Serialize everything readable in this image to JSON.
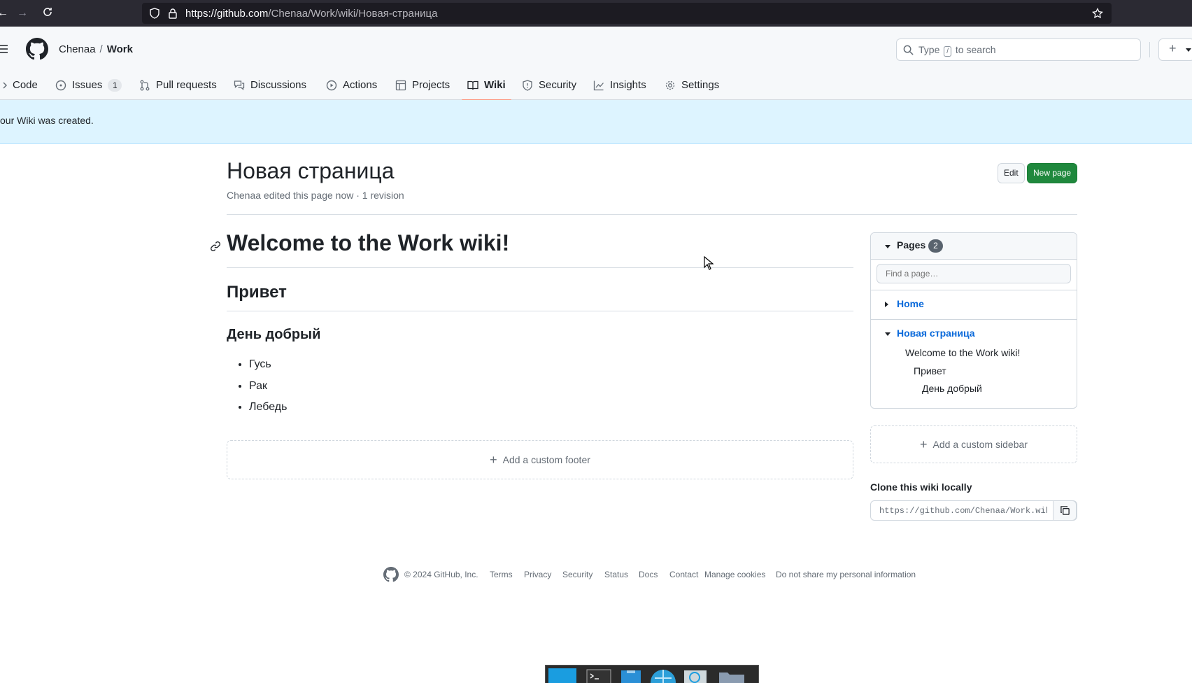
{
  "browser": {
    "url_host": "https://github.com",
    "url_path": "/Chenaa/Work/wiki/Новая-страница"
  },
  "header": {
    "owner": "Chenaa",
    "separator": "/",
    "repo": "Work",
    "search_placeholder_pre": "Type",
    "search_slash": "/",
    "search_placeholder_post": "to search",
    "plus_label": "+"
  },
  "tabs": [
    {
      "label": "Code"
    },
    {
      "label": "Issues",
      "count": "1"
    },
    {
      "label": "Pull requests"
    },
    {
      "label": "Discussions"
    },
    {
      "label": "Actions"
    },
    {
      "label": "Projects"
    },
    {
      "label": "Wiki"
    },
    {
      "label": "Security"
    },
    {
      "label": "Insights"
    },
    {
      "label": "Settings"
    }
  ],
  "flash": {
    "message": "our Wiki was created."
  },
  "page": {
    "title": "Новая страница",
    "meta": "Chenaa edited this page now · 1 revision",
    "edit_label": "Edit",
    "new_page_label": "New page"
  },
  "content": {
    "h1": "Welcome to the Work wiki!",
    "h2": "Привет",
    "h3": "День добрый",
    "list": [
      "Гусь",
      "Рак",
      "Лебедь"
    ],
    "footer_add": "Add a custom footer"
  },
  "sidebar": {
    "pages_label": "Pages",
    "pages_count": "2",
    "find_placeholder": "Find a page…",
    "pages": [
      {
        "title": "Home"
      },
      {
        "title": "Новая страница",
        "toc": [
          "Welcome to the Work wiki!",
          "Привет",
          "День добрый"
        ]
      }
    ],
    "add_sidebar": "Add a custom sidebar",
    "clone_heading": "Clone this wiki locally",
    "clone_url": "https://github.com/Chenaa/Work.wiki.git"
  },
  "footer": {
    "copyright": "© 2024 GitHub, Inc.",
    "links": [
      "Terms",
      "Privacy",
      "Security",
      "Status",
      "Docs",
      "Contact",
      "Manage cookies",
      "Do not share my personal information"
    ]
  },
  "colors": {
    "accent": "#0969da",
    "primary_button": "#1f883d",
    "flash_bg": "#ddf4ff",
    "tab_underline": "#fd8c73"
  }
}
